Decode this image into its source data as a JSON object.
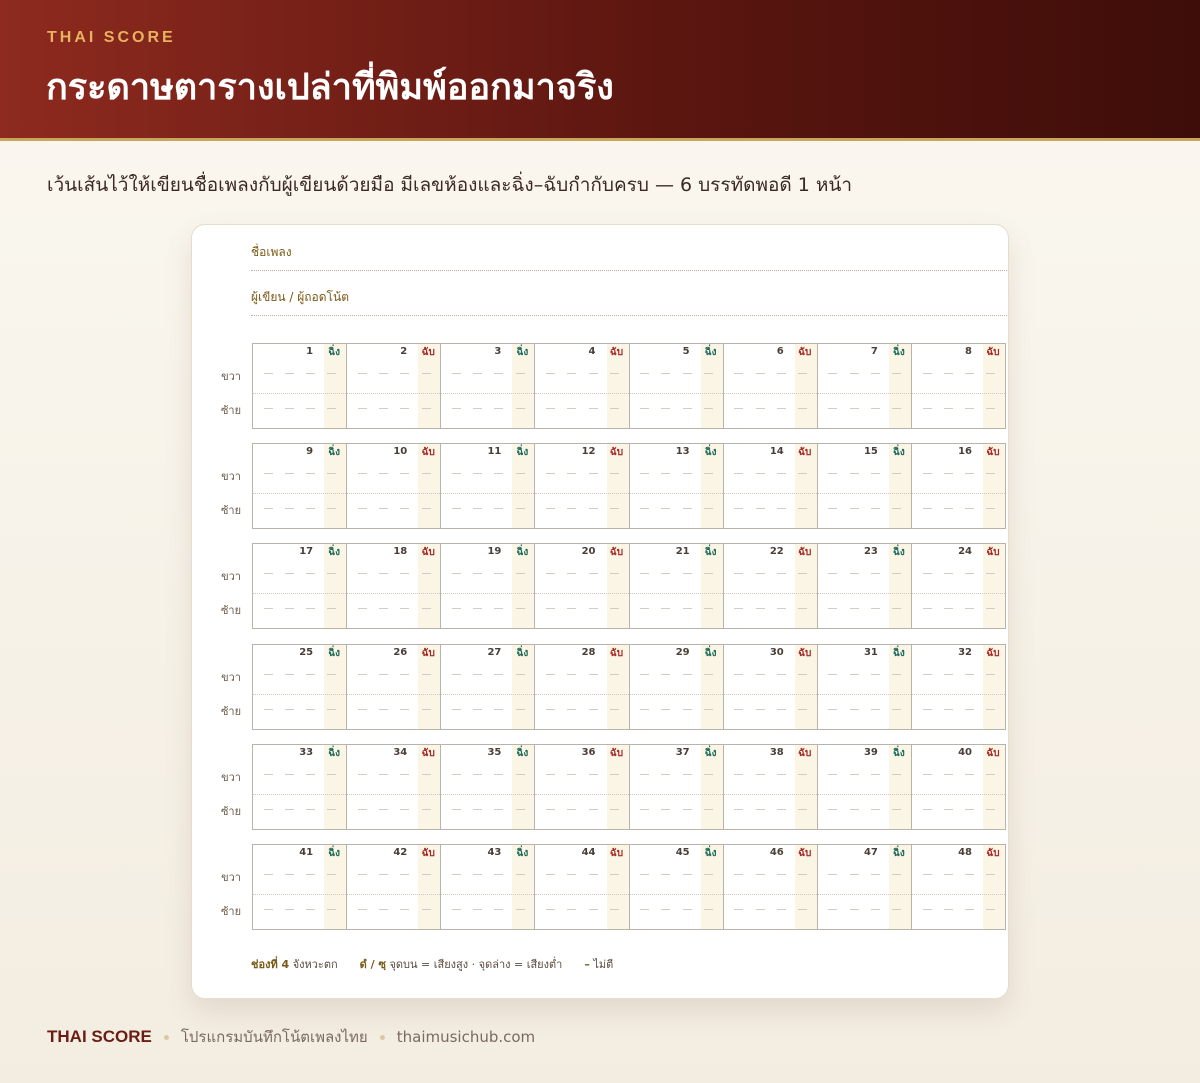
{
  "header": {
    "brand": "THAI SCORE",
    "title": "กระดาษตารางเปล่าที่พิมพ์ออกมาจริง"
  },
  "subtitle": "เว้นเส้นไว้ให้เขียนชื่อเพลงกับผู้เขียนด้วยมือ มีเลขห้องและฉิ่ง–ฉับกำกับครบ — 6 บรรทัดพอดี 1 หน้า",
  "sheet": {
    "song_title_label": "ชื่อเพลง",
    "author_label": "ผู้เขียน / ผู้ถอดโน้ต",
    "hand_labels": {
      "right": "ขวา",
      "left": "ซ้าย"
    },
    "ching_open": "ฉิ่ง",
    "ching_closed": "ฉับ",
    "blank_mark": "—",
    "lines": [
      {
        "measures": [
          "1",
          "2",
          "3",
          "4",
          "5",
          "6",
          "7",
          "8"
        ]
      },
      {
        "measures": [
          "9",
          "10",
          "11",
          "12",
          "13",
          "14",
          "15",
          "16"
        ]
      },
      {
        "measures": [
          "17",
          "18",
          "19",
          "20",
          "21",
          "22",
          "23",
          "24"
        ]
      },
      {
        "measures": [
          "25",
          "26",
          "27",
          "28",
          "29",
          "30",
          "31",
          "32"
        ]
      },
      {
        "measures": [
          "33",
          "34",
          "35",
          "36",
          "37",
          "38",
          "39",
          "40"
        ]
      },
      {
        "measures": [
          "41",
          "42",
          "43",
          "44",
          "45",
          "46",
          "47",
          "48"
        ]
      }
    ],
    "legend": {
      "strong_beat_bold": "ช่องที่ 4",
      "strong_beat_text": "จังหวะตก",
      "octave_bold": "ดํ / ซฺ",
      "octave_text": "จุดบน = เสียงสูง · จุดล่าง = เสียงต่ำ",
      "rest_mark": "–",
      "rest_text": "ไม่ตี"
    }
  },
  "footer": {
    "brand": "THAI SCORE",
    "tagline": "โปรแกรมบันทึกโน้ตเพลงไทย",
    "site": "thaimusichub.com"
  }
}
